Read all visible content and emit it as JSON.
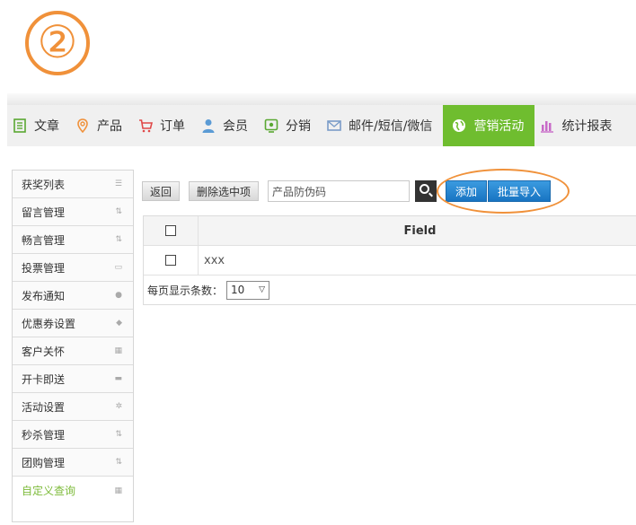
{
  "step": {
    "number": "②",
    "color": "#f0913a"
  },
  "nav": {
    "items": [
      {
        "label": "文章",
        "icon": "document-icon",
        "color": "#5aa832"
      },
      {
        "label": "产品",
        "icon": "location-pin-icon",
        "color": "#f0913a"
      },
      {
        "label": "订单",
        "icon": "cart-icon",
        "color": "#e04848"
      },
      {
        "label": "会员",
        "icon": "user-icon",
        "color": "#5b9bd5"
      },
      {
        "label": "分销",
        "icon": "share-screen-icon",
        "color": "#5aa832"
      },
      {
        "label": "邮件/短信/微信",
        "icon": "envelope-icon",
        "color": "#7a9cc8"
      },
      {
        "label": "营销活动",
        "icon": "globe-icon",
        "color": "#ffffff",
        "active": true
      },
      {
        "label": "统计报表",
        "icon": "bar-chart-icon",
        "color": "#c86ac8"
      }
    ],
    "active_color": "#6fbd2f"
  },
  "sidebar": {
    "items": [
      {
        "label": "获奖列表",
        "icon": "list-icon"
      },
      {
        "label": "留言管理",
        "icon": "refresh-icon"
      },
      {
        "label": "畅言管理",
        "icon": "refresh-icon"
      },
      {
        "label": "投票管理",
        "icon": "monitor-icon"
      },
      {
        "label": "发布通知",
        "icon": "chat-icon"
      },
      {
        "label": "优惠券设置",
        "icon": "tag-icon"
      },
      {
        "label": "客户关怀",
        "icon": "grid-icon"
      },
      {
        "label": "开卡即送",
        "icon": "inbox-icon"
      },
      {
        "label": "活动设置",
        "icon": "gear-icon"
      },
      {
        "label": "秒杀管理",
        "icon": "refresh-icon"
      },
      {
        "label": "团购管理",
        "icon": "refresh-icon"
      },
      {
        "label": "自定义查询",
        "icon": "grid-icon",
        "active": true
      }
    ],
    "active_color": "#7dbb3a"
  },
  "toolbar": {
    "back_label": "返回",
    "delete_label": "删除选中项",
    "search_value": "产品防伪码",
    "add_label": "添加",
    "import_label": "批量导入"
  },
  "table": {
    "header": "Field",
    "rows": [
      {
        "value": "xxx"
      }
    ]
  },
  "pager": {
    "label": "每页显示条数：",
    "page_size": "10"
  }
}
